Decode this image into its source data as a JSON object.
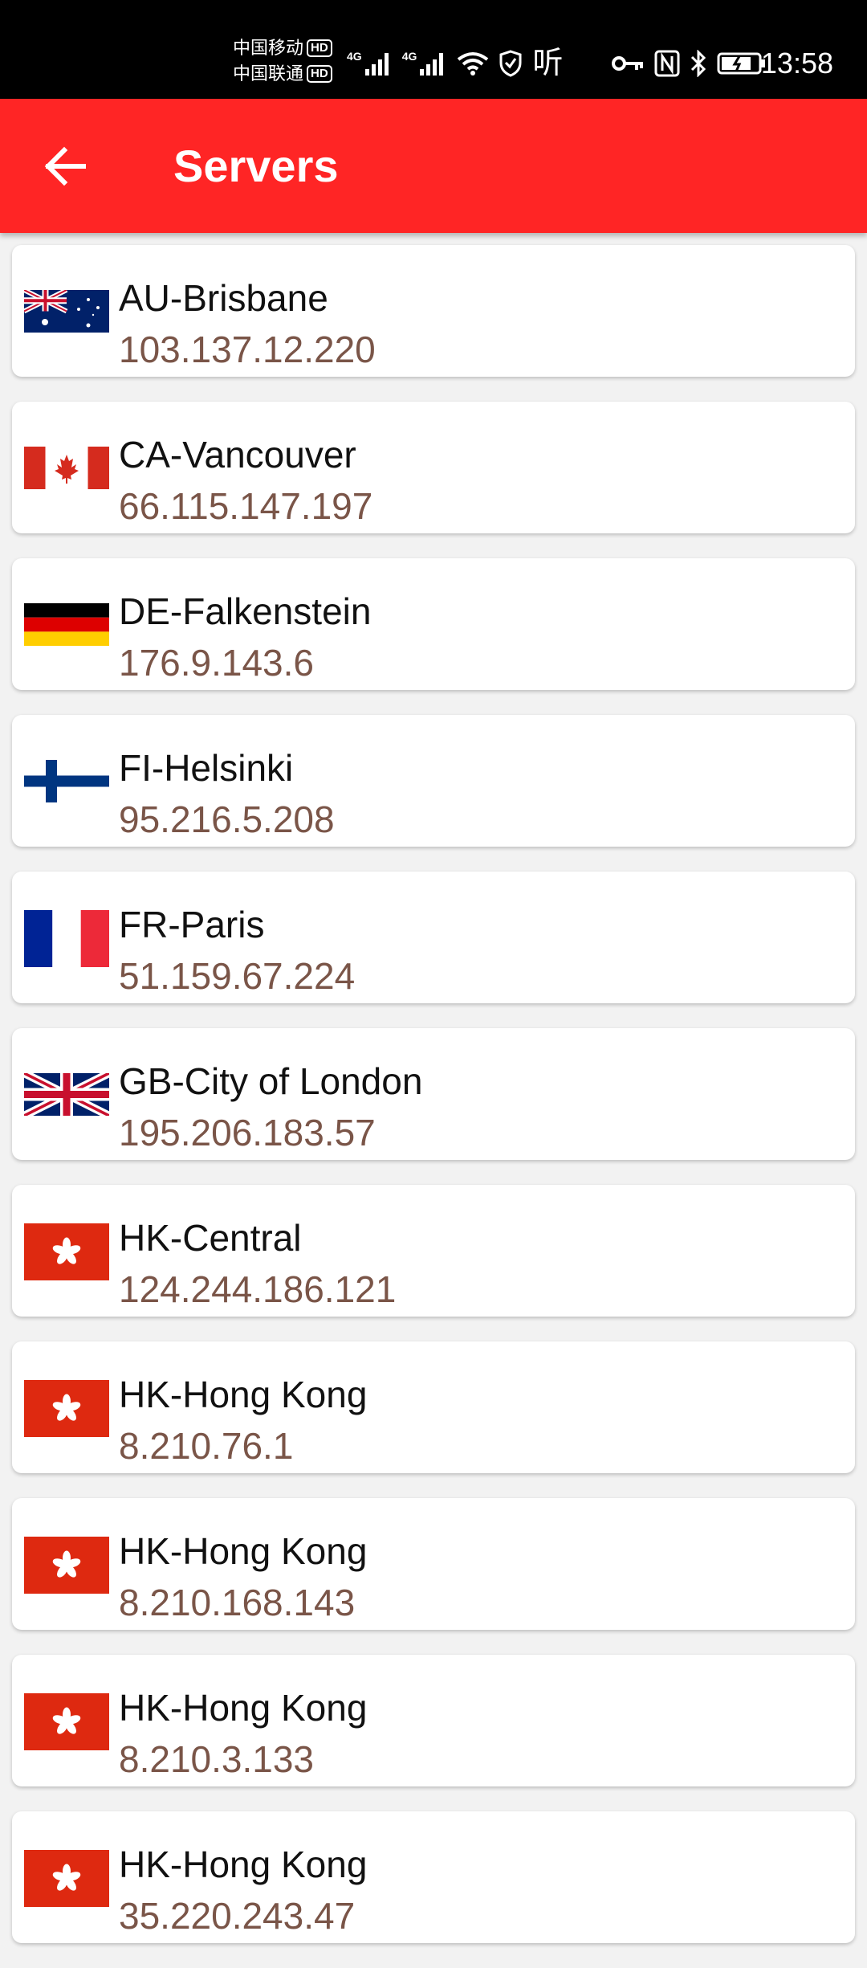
{
  "status_bar": {
    "carrier_1": "中国移动",
    "carrier_2": "中国联通",
    "hd_badge": "HD",
    "net_1": "4G",
    "net_2": "4G",
    "listen_label": "听",
    "time": "13:58",
    "icons": [
      "signal-icon",
      "signal-icon",
      "wifi-icon",
      "shield-icon",
      "key-icon",
      "nfc-icon",
      "bluetooth-icon",
      "battery-icon"
    ]
  },
  "app_bar": {
    "title": "Servers",
    "back_icon": "arrow-left-icon",
    "color": "#ff2525"
  },
  "servers": [
    {
      "name": "AU-Brisbane",
      "ip": "103.137.12.220",
      "flag": "au-flag-icon"
    },
    {
      "name": "CA-Vancouver",
      "ip": "66.115.147.197",
      "flag": "ca-flag-icon"
    },
    {
      "name": "DE-Falkenstein",
      "ip": "176.9.143.6",
      "flag": "de-flag-icon"
    },
    {
      "name": "FI-Helsinki",
      "ip": "95.216.5.208",
      "flag": "fi-flag-icon"
    },
    {
      "name": "FR-Paris",
      "ip": "51.159.67.224",
      "flag": "fr-flag-icon"
    },
    {
      "name": "GB-City of London",
      "ip": "195.206.183.57",
      "flag": "gb-flag-icon"
    },
    {
      "name": "HK-Central",
      "ip": "124.244.186.121",
      "flag": "hk-flag-icon"
    },
    {
      "name": "HK-Hong Kong",
      "ip": "8.210.76.1",
      "flag": "hk-flag-icon"
    },
    {
      "name": "HK-Hong Kong",
      "ip": "8.210.168.143",
      "flag": "hk-flag-icon"
    },
    {
      "name": "HK-Hong Kong",
      "ip": "8.210.3.133",
      "flag": "hk-flag-icon"
    },
    {
      "name": "HK-Hong Kong",
      "ip": "35.220.243.47",
      "flag": "hk-flag-icon"
    }
  ],
  "colors": {
    "ip_text": "#7a5548",
    "name_text": "#111111"
  }
}
